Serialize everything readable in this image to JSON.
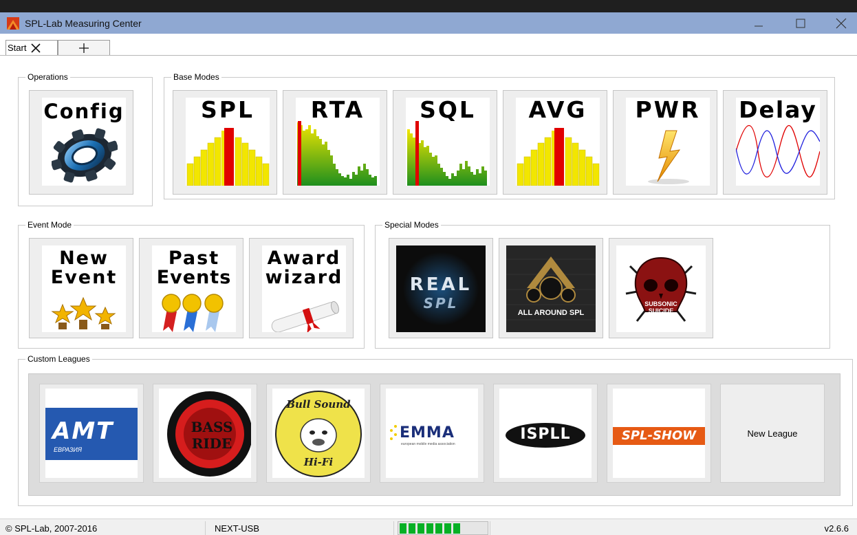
{
  "window": {
    "title": "SPL-Lab Measuring Center",
    "minimize_icon": "minimize-icon",
    "maximize_icon": "maximize-icon",
    "close_icon": "close-icon"
  },
  "tabs": [
    {
      "label": "Start",
      "close_icon": "close-icon"
    },
    {
      "label": "+",
      "icon": "plus-icon"
    }
  ],
  "groups": {
    "operations": "Operations",
    "base_modes": "Base Modes",
    "event_mode": "Event Mode",
    "special_modes": "Special Modes",
    "custom_leagues": "Custom Leagues"
  },
  "operations": [
    {
      "label": "Config",
      "icon": "gear-icon"
    }
  ],
  "base_modes": [
    {
      "label": "SPL",
      "icon": "level-bars-icon"
    },
    {
      "label": "RTA",
      "icon": "spectrum-icon"
    },
    {
      "label": "SQL",
      "icon": "spectrum-icon"
    },
    {
      "label": "AVG",
      "icon": "level-bars-icon"
    },
    {
      "label": "PWR",
      "icon": "lightning-icon"
    },
    {
      "label": "Delay",
      "icon": "sine-wave-icon"
    }
  ],
  "event_mode": [
    {
      "line1": "New",
      "line2": "Event",
      "icon": "trophy-stars-icon"
    },
    {
      "line1": "Past",
      "line2": "Events",
      "icon": "ribbons-icon"
    },
    {
      "line1": "Award",
      "line2": "wizard",
      "icon": "scroll-icon"
    }
  ],
  "special_modes": [
    {
      "logo_line1": "REAL",
      "logo_line2": "SPL",
      "icon": "real-spl-logo"
    },
    {
      "logo_text": "ALL AROUND SPL",
      "icon": "all-around-spl-logo"
    },
    {
      "logo_line1": "SUBSONIC",
      "logo_line2": "SUICIDE",
      "icon": "skull-logo"
    }
  ],
  "custom_leagues": [
    {
      "logo_text": "AMT",
      "logo_sub": "ЕВРАЗИЯ",
      "icon": "amt-logo"
    },
    {
      "logo_line1": "BASS",
      "logo_line2": "RIDE",
      "icon": "bass-ride-logo"
    },
    {
      "logo_line1": "Bull Sound",
      "logo_line2": "Hi-Fi",
      "icon": "bull-sound-logo"
    },
    {
      "logo_text": "EMMA",
      "logo_sub": "european mobile media association",
      "icon": "emma-logo"
    },
    {
      "logo_text": "ISPLL",
      "icon": "ispll-logo"
    },
    {
      "logo_text": "SPL-SHOW",
      "icon": "spl-show-logo"
    },
    {
      "label": "New League"
    }
  ],
  "status": {
    "copyright": "© SPL-Lab, 2007-2016",
    "device": "NEXT-USB",
    "signal_level": 1.0,
    "version": "v2.6.6"
  },
  "colors": {
    "titlebar": "#8fa8d2",
    "bar_yellow": "#f2e600",
    "bar_red": "#e00000",
    "spectrum_green": "#2fa52f"
  }
}
